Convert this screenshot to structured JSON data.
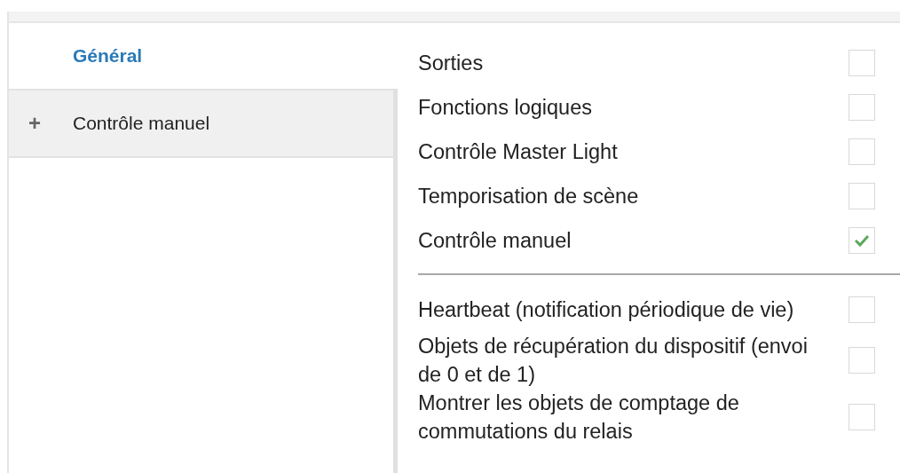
{
  "sidebar": {
    "items": [
      {
        "label": "Général",
        "selected": true
      },
      {
        "label": "Contrôle manuel",
        "selected": false,
        "expander": "+"
      }
    ]
  },
  "settings": {
    "groups": [
      [
        {
          "label": "Sorties",
          "checked": false
        },
        {
          "label": "Fonctions logiques",
          "checked": false
        },
        {
          "label": "Contrôle Master Light",
          "checked": false
        },
        {
          "label": "Temporisation de scène",
          "checked": false
        },
        {
          "label": "Contrôle manuel",
          "checked": true
        }
      ],
      [
        {
          "label": "Heartbeat (notification périodique de vie)",
          "checked": false
        },
        {
          "label": "Objets de récupération du dispositif (envoi de 0 et de 1)",
          "checked": false
        },
        {
          "label": "Montrer les objets de comptage de commutations du relais",
          "checked": false
        }
      ]
    ]
  }
}
